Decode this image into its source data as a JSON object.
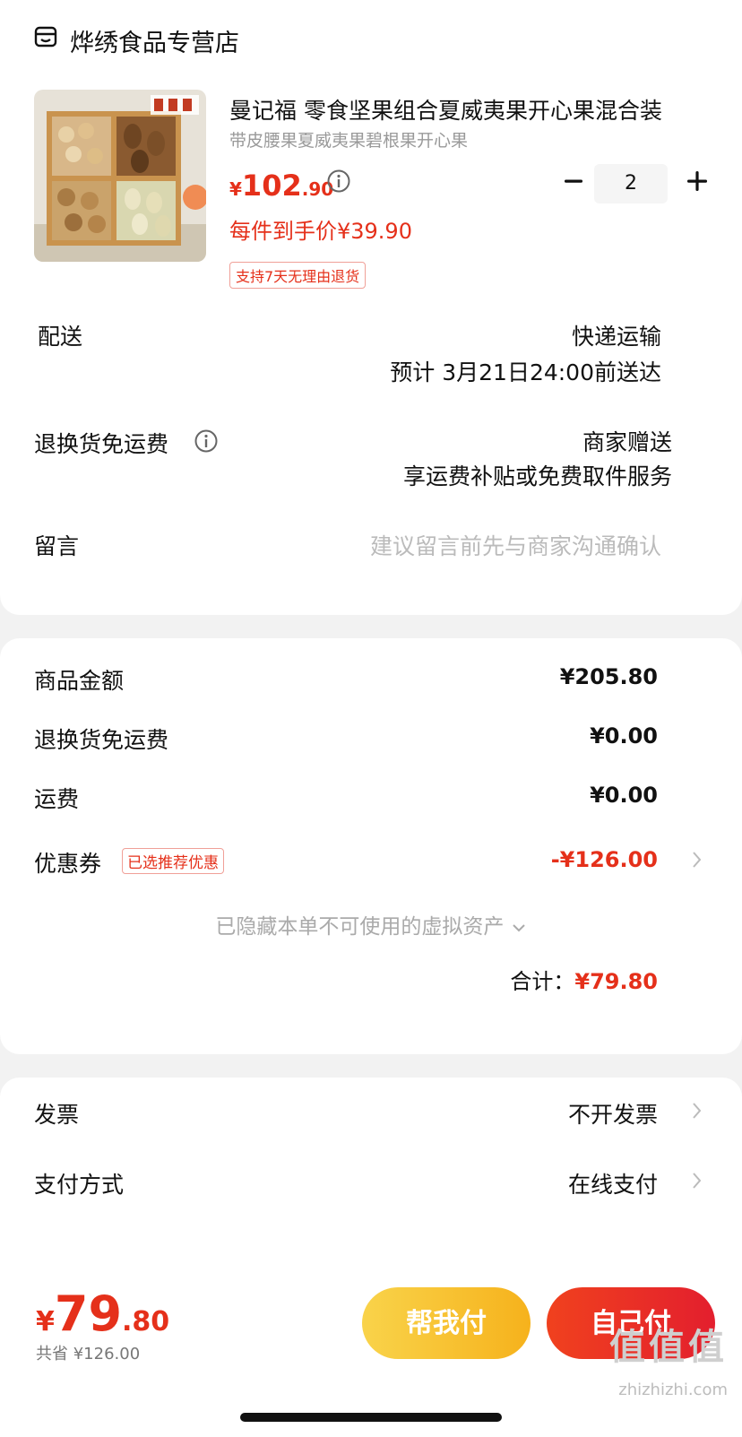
{
  "store": {
    "name": "烨绣食品专营店",
    "icon": "store-icon"
  },
  "product": {
    "title": "曼记福 零食坚果组合夏威夷果开心果混合装",
    "subtitle": "带皮腰果夏威夷果碧根果开心果",
    "price_symbol": "¥",
    "price_int": "102",
    "price_dec": ".90",
    "deal_price": "每件到手价¥39.90",
    "return_tag": "支持7天无理由退货",
    "quantity": "2"
  },
  "delivery": {
    "label": "配送",
    "method": "快递运输",
    "eta": "预计 3月21日24:00前送达"
  },
  "return_shipping": {
    "label": "退换货免运费",
    "value": "商家赠送",
    "desc": "享运费补贴或免费取件服务"
  },
  "message": {
    "label": "留言",
    "placeholder": "建议留言前先与商家沟通确认"
  },
  "summary": {
    "goods_label": "商品金额",
    "goods_value": "¥205.80",
    "return_label": "退换货免运费",
    "return_value": "¥0.00",
    "ship_label": "运费",
    "ship_value": "¥0.00",
    "coupon_label": "优惠券",
    "coupon_badge": "已选推荐优惠",
    "coupon_value": "-¥126.00",
    "hidden_note": "已隐藏本单不可使用的虚拟资产",
    "total_label": "合计：",
    "total_value": "¥79.80"
  },
  "invoice": {
    "label": "发票",
    "value": "不开发票"
  },
  "payment": {
    "label": "支付方式",
    "value": "在线支付"
  },
  "bottom": {
    "symbol": "¥",
    "int": "79",
    "dec": ".80",
    "saved": "共省 ¥126.00",
    "help_pay": "帮我付",
    "self_pay": "自己付"
  },
  "watermark": {
    "logo": "值值值",
    "site": "zhizhizhi.com"
  },
  "colors": {
    "accent": "#e5301a",
    "help_btn": "#f7c232",
    "self_btn": "#e8291f"
  }
}
